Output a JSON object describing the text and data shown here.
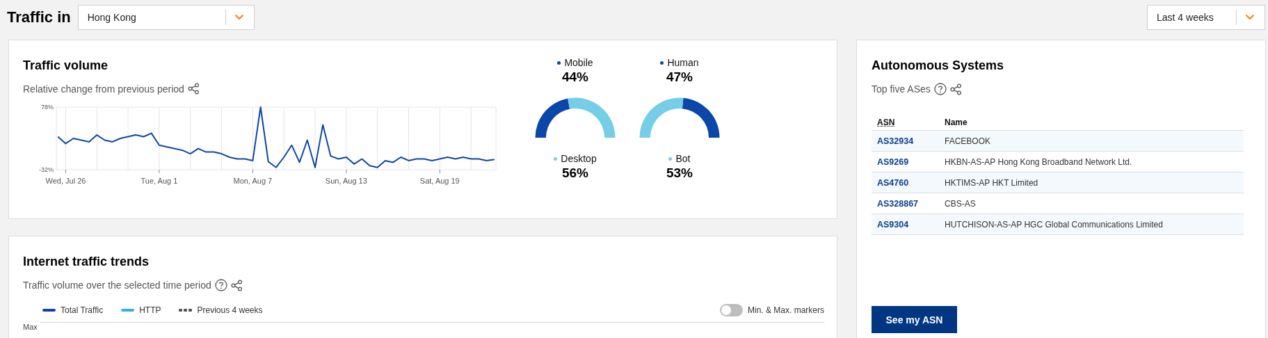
{
  "header": {
    "title": "Traffic in",
    "location": {
      "value": "Hong Kong"
    },
    "period": {
      "value": "Last 4 weeks"
    }
  },
  "traffic_volume": {
    "title": "Traffic volume",
    "subtitle": "Relative change from previous period",
    "chart_data": {
      "type": "line",
      "categories": [
        null,
        "Wed, Jul 26",
        null,
        null,
        null,
        null,
        null,
        null,
        null,
        null,
        null,
        null,
        null,
        "Tue, Aug 1",
        null,
        null,
        null,
        null,
        null,
        null,
        null,
        null,
        null,
        null,
        null,
        "Mon, Aug 7",
        null,
        null,
        null,
        null,
        null,
        null,
        null,
        null,
        null,
        null,
        null,
        "Sun, Aug 13",
        null,
        null,
        null,
        null,
        null,
        null,
        null,
        null,
        null,
        null,
        null,
        "Sat, Aug 19",
        null,
        null,
        null,
        null,
        null,
        null,
        null
      ],
      "series": [
        {
          "color": "#0a47a8",
          "values": [
            26,
            14,
            23,
            20,
            17,
            29,
            20,
            17,
            23,
            26,
            29,
            26,
            32,
            11,
            8,
            5,
            2,
            -4,
            5,
            -1,
            -1,
            -4,
            -10,
            -13,
            -13,
            -16,
            78,
            -18,
            -28,
            -10,
            11,
            -19,
            20,
            -28,
            47,
            -8,
            -13,
            -10,
            -22,
            -13,
            -25,
            -28,
            -16,
            -19,
            -10,
            -16,
            -13,
            -13,
            -16,
            -13,
            -10,
            -13,
            -10,
            -13,
            -13,
            -16,
            -14
          ]
        }
      ],
      "ylim": [
        -32,
        78
      ],
      "grid": true,
      "yticks": [
        {
          "value": 78,
          "label": "78%"
        },
        {
          "value": -32,
          "label": "-32%"
        }
      ]
    },
    "gauges": [
      {
        "top": {
          "label": "Mobile",
          "value": "44%",
          "color": "#0a47a8"
        },
        "bottom": {
          "label": "Desktop",
          "value": "56%",
          "color": "#76cde6"
        }
      },
      {
        "top": {
          "label": "Human",
          "value": "47%",
          "color": "#0a47a8"
        },
        "bottom": {
          "label": "Bot",
          "value": "53%",
          "color": "#76cde6"
        }
      }
    ]
  },
  "trends": {
    "title": "Internet traffic trends",
    "subtitle": "Traffic volume over the selected time period",
    "legend": [
      {
        "label": "Total Traffic",
        "kind": "solid",
        "color": "#0a47a8"
      },
      {
        "label": "HTTP",
        "kind": "solid",
        "color": "#2fb3e0"
      },
      {
        "label": "Previous 4 weeks",
        "kind": "dashed",
        "color": "#555555"
      }
    ],
    "toggle": {
      "label": "Min. & Max. markers",
      "on": false
    },
    "y_label": "Max"
  },
  "autonomous_systems": {
    "title": "Autonomous Systems",
    "subtitle": "Top five ASes",
    "columns": [
      "ASN",
      "Name"
    ],
    "rows": [
      {
        "asn": "AS32934",
        "name": "FACEBOOK"
      },
      {
        "asn": "AS9269",
        "name": "HKBN-AS-AP Hong Kong Broadband Network Ltd."
      },
      {
        "asn": "AS4760",
        "name": "HKTIMS-AP HKT Limited"
      },
      {
        "asn": "AS328867",
        "name": "CBS-AS"
      },
      {
        "asn": "AS9304",
        "name": "HUTCHISON-AS-AP HGC Global Communications Limited"
      }
    ],
    "button": "See my ASN"
  }
}
